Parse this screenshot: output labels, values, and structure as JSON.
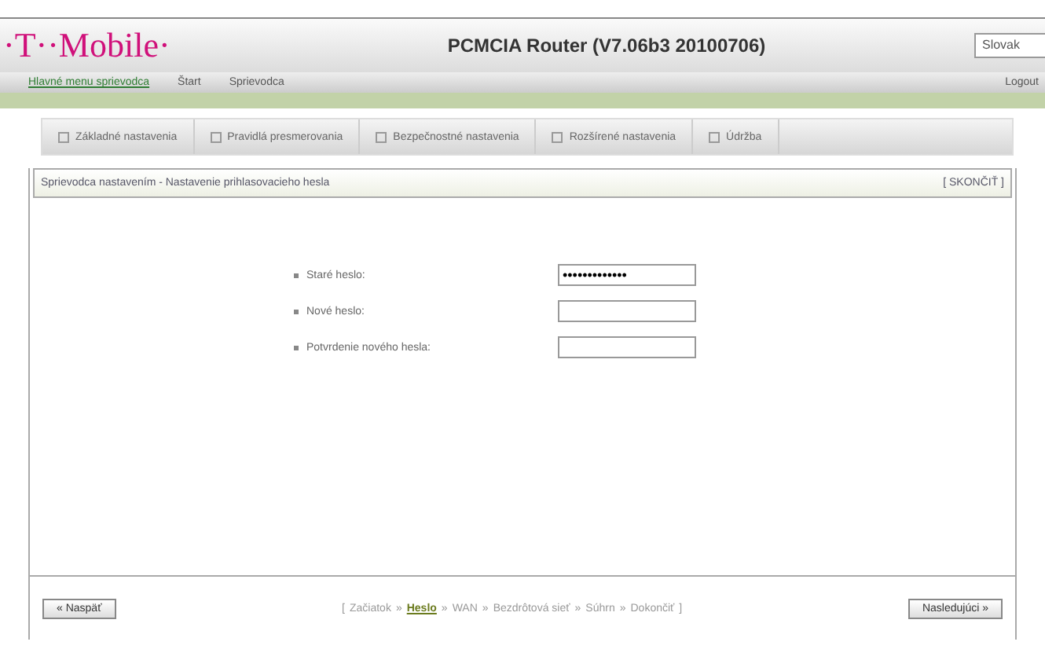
{
  "header": {
    "logo": "·T··Mobile·",
    "title": "PCMCIA Router (V7.06b3 20100706)",
    "language": "Slovak"
  },
  "nav": {
    "items": [
      {
        "label": "Hlavné menu sprievodca",
        "selected": true
      },
      {
        "label": "Štart",
        "selected": false
      },
      {
        "label": "Sprievodca",
        "selected": false
      }
    ],
    "logout": "Logout"
  },
  "tabs": [
    {
      "label": "Základné nastavenia"
    },
    {
      "label": "Pravidlá presmerovania"
    },
    {
      "label": "Bezpečnostné nastavenia"
    },
    {
      "label": "Rozšírené nastavenia"
    },
    {
      "label": "Údržba"
    }
  ],
  "panel": {
    "title": "Sprievodca nastavením - Nastavenie prihlasovacieho hesla",
    "close": "[ SKONČIŤ ]"
  },
  "fields": [
    {
      "label": "Staré heslo:",
      "value": "•••••••••••••"
    },
    {
      "label": "Nové heslo:"
    },
    {
      "label": "Potvrdenie nového hesla:"
    }
  ],
  "footer": {
    "back": "« Naspäť",
    "next": "Nasledujúci »",
    "open": "[",
    "close": "]",
    "separator": "»",
    "steps": [
      {
        "label": "Začiatok",
        "selected": false
      },
      {
        "label": "Heslo",
        "selected": true
      },
      {
        "label": "WAN",
        "selected": false
      },
      {
        "label": "Bezdrôtová sieť",
        "selected": false
      },
      {
        "label": "Súhrn",
        "selected": false
      },
      {
        "label": "Dokončiť",
        "selected": false
      }
    ]
  }
}
